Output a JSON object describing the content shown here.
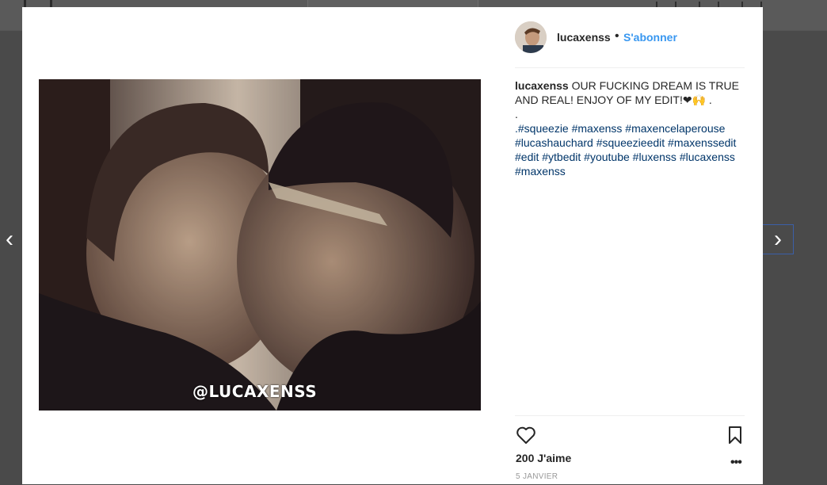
{
  "post": {
    "username": "lucaxenss",
    "separator": "•",
    "follow_label": "S'abonner",
    "caption_user": "lucaxenss",
    "caption_text": " OUR FUCKING DREAM IS TRUE AND REAL! ENJOY OF MY EDIT!❤🙌 .",
    "caption_dot": ".",
    "hashtags": ".#squeezie #maxenss #maxencelaperouse #lucashauchard #squeezieedit #maxenssedit #edit #ytbedit #youtube #luxenss #lucaxenss #maxenss",
    "watermark": "@LUCAXENSS",
    "likes": "200 J'aime",
    "more": "•••",
    "date": "5 JANVIER"
  },
  "navigation": {
    "prev_glyph": "‹",
    "next_glyph": "›"
  },
  "colors": {
    "link_blue": "#3897f0",
    "hashtag_blue": "#003569",
    "overlay": "#4a4a4a"
  },
  "icons": {
    "like": "heart-icon",
    "save": "bookmark-icon",
    "more": "more-options-icon"
  }
}
